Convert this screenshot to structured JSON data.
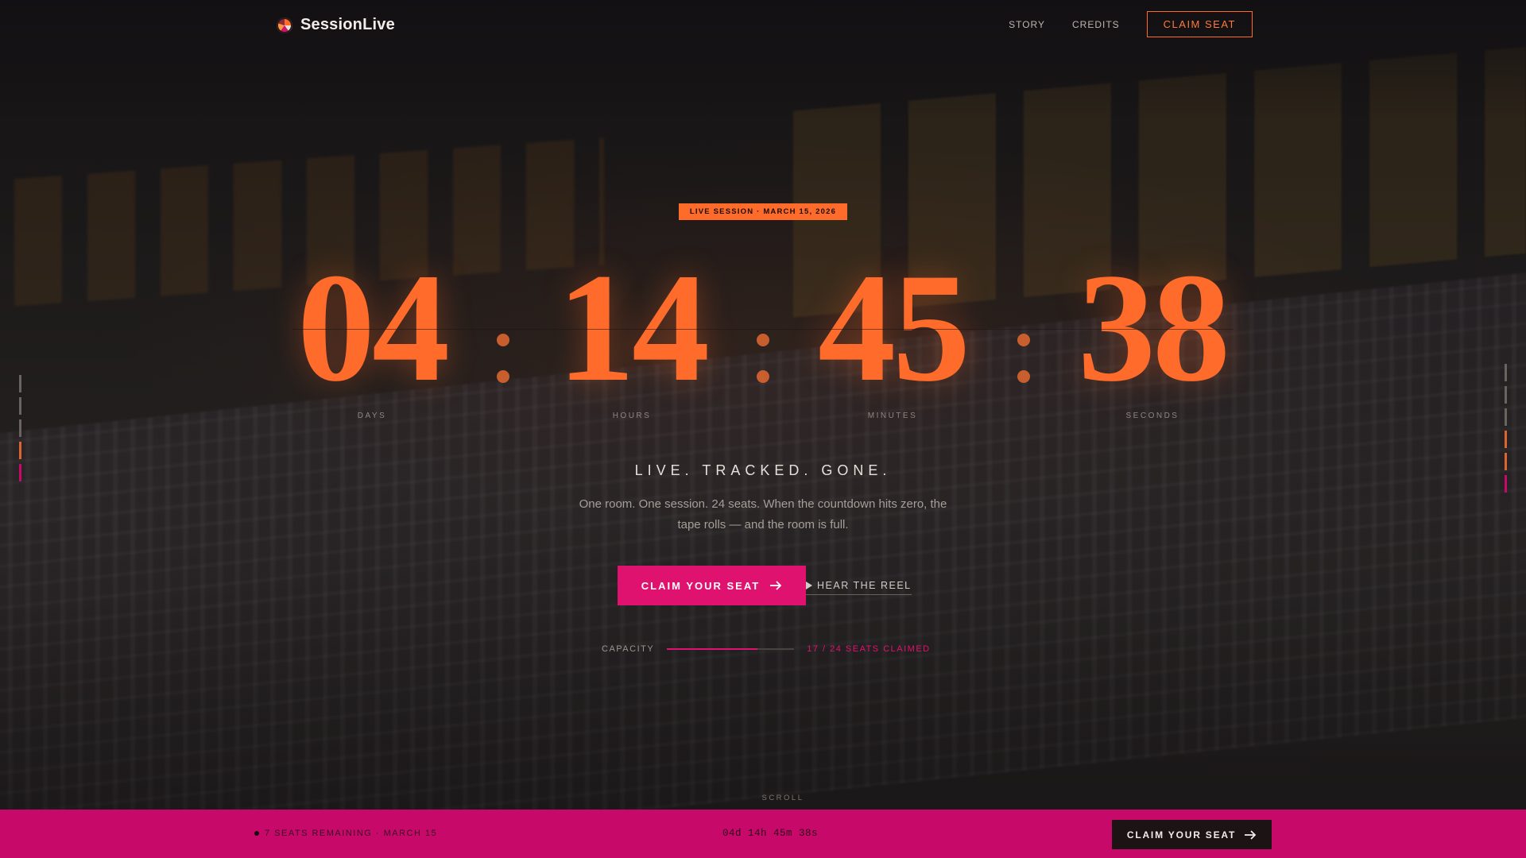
{
  "brand": {
    "name": "SessionLive",
    "icon": "vinyl-logo-icon"
  },
  "nav": {
    "items": [
      {
        "label": "STORY"
      },
      {
        "label": "CREDITS"
      }
    ],
    "cta_label": "CLAIM SEAT"
  },
  "hero": {
    "badge": "LIVE SESSION · MARCH 15, 2026",
    "countdown": [
      {
        "value": "04",
        "label": "DAYS"
      },
      {
        "value": "14",
        "label": "HOURS"
      },
      {
        "value": "45",
        "label": "MINUTES"
      },
      {
        "value": "38",
        "label": "SECONDS"
      }
    ],
    "tagline": "LIVE. TRACKED. GONE.",
    "description": "One room. One session. 24 seats. When the countdown hits zero, the tape rolls — and the room is full.",
    "primary_cta": "CLAIM YOUR SEAT",
    "secondary_cta": "HEAR THE REEL",
    "capacity": {
      "label": "CAPACITY",
      "claimed": 17,
      "total": 24,
      "count_text": "17 / 24 SEATS CLAIMED"
    },
    "scroll_hint": "SCROLL"
  },
  "bottom_bar": {
    "status": "7 SEATS REMAINING · MARCH 15",
    "timer": "04d 14h 45m 38s",
    "cta_label": "CLAIM YOUR SEAT"
  },
  "colors": {
    "accent_orange": "#ff6b2b",
    "accent_pink": "#e0126f",
    "bar_pink": "#c7096a",
    "background": "#141214"
  },
  "side_markers": {
    "left": [
      "#6b6360",
      "#6b6360",
      "#6b6360",
      "#d96530",
      "#c7096a"
    ],
    "right": [
      "#6b6360",
      "#6b6360",
      "#6b6360",
      "#d96530",
      "#d96530",
      "#c7096a"
    ]
  }
}
